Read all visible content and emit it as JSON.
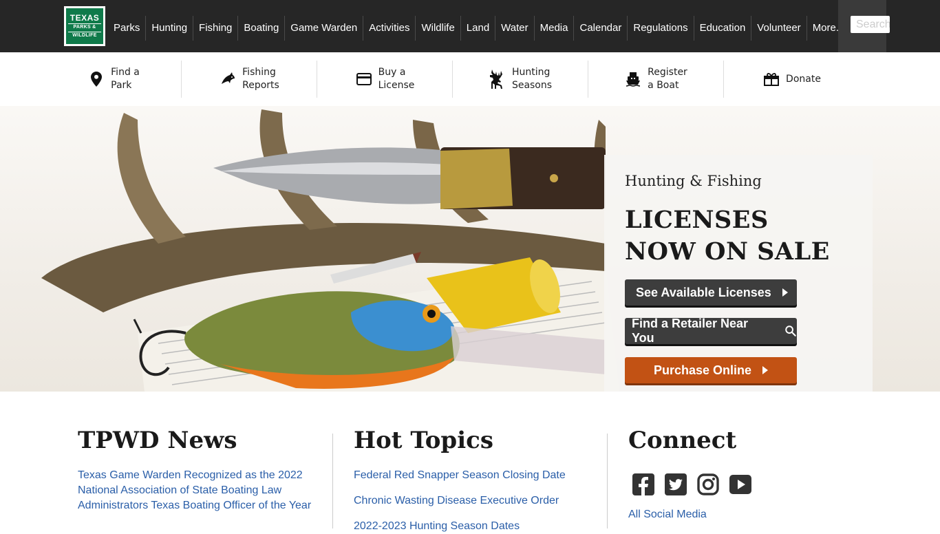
{
  "logo": {
    "line1": "TEXAS",
    "line2": "PARKS &",
    "line3": "WILDLIFE"
  },
  "nav": [
    "Parks",
    "Hunting",
    "Fishing",
    "Boating",
    "Game Warden",
    "Activities",
    "Wildlife",
    "Land",
    "Water",
    "Media",
    "Calendar",
    "Regulations",
    "Education",
    "Volunteer",
    "More..."
  ],
  "search": {
    "placeholder": "Search"
  },
  "quick_links": [
    {
      "label": "Find a\nPark",
      "icon": "map-pin-icon"
    },
    {
      "label": "Fishing\nReports",
      "icon": "fish-icon"
    },
    {
      "label": "Buy a\nLicense",
      "icon": "credit-card-icon"
    },
    {
      "label": "Hunting\nSeasons",
      "icon": "deer-icon"
    },
    {
      "label": "Register\na Boat",
      "icon": "boat-icon"
    },
    {
      "label": "Donate",
      "icon": "gift-icon"
    }
  ],
  "promo": {
    "subtitle": "Hunting & Fishing",
    "title": "LICENSES\nNOW ON SALE",
    "btn_licenses": "See Available Licenses",
    "btn_retailer": "Find a Retailer Near You",
    "btn_purchase": "Purchase Online"
  },
  "news": {
    "title": "TPWD News",
    "items": [
      "Texas Game Warden Recognized as the 2022 National Association of State Boating Law Administrators Texas Boating Officer of the Year"
    ]
  },
  "hot_topics": {
    "title": "Hot Topics",
    "items": [
      "Federal Red Snapper Season Closing Date",
      "Chronic Wasting Disease Executive Order",
      "2022-2023 Hunting Season Dates"
    ]
  },
  "connect": {
    "title": "Connect",
    "icons": [
      "facebook-icon",
      "twitter-icon",
      "instagram-icon",
      "youtube-icon"
    ],
    "all_social": "All Social Media"
  },
  "colors": {
    "topnav": "#262626",
    "logo_green": "#0f7a4a",
    "link_blue": "#2a5ea8",
    "orange": "#c25214"
  }
}
